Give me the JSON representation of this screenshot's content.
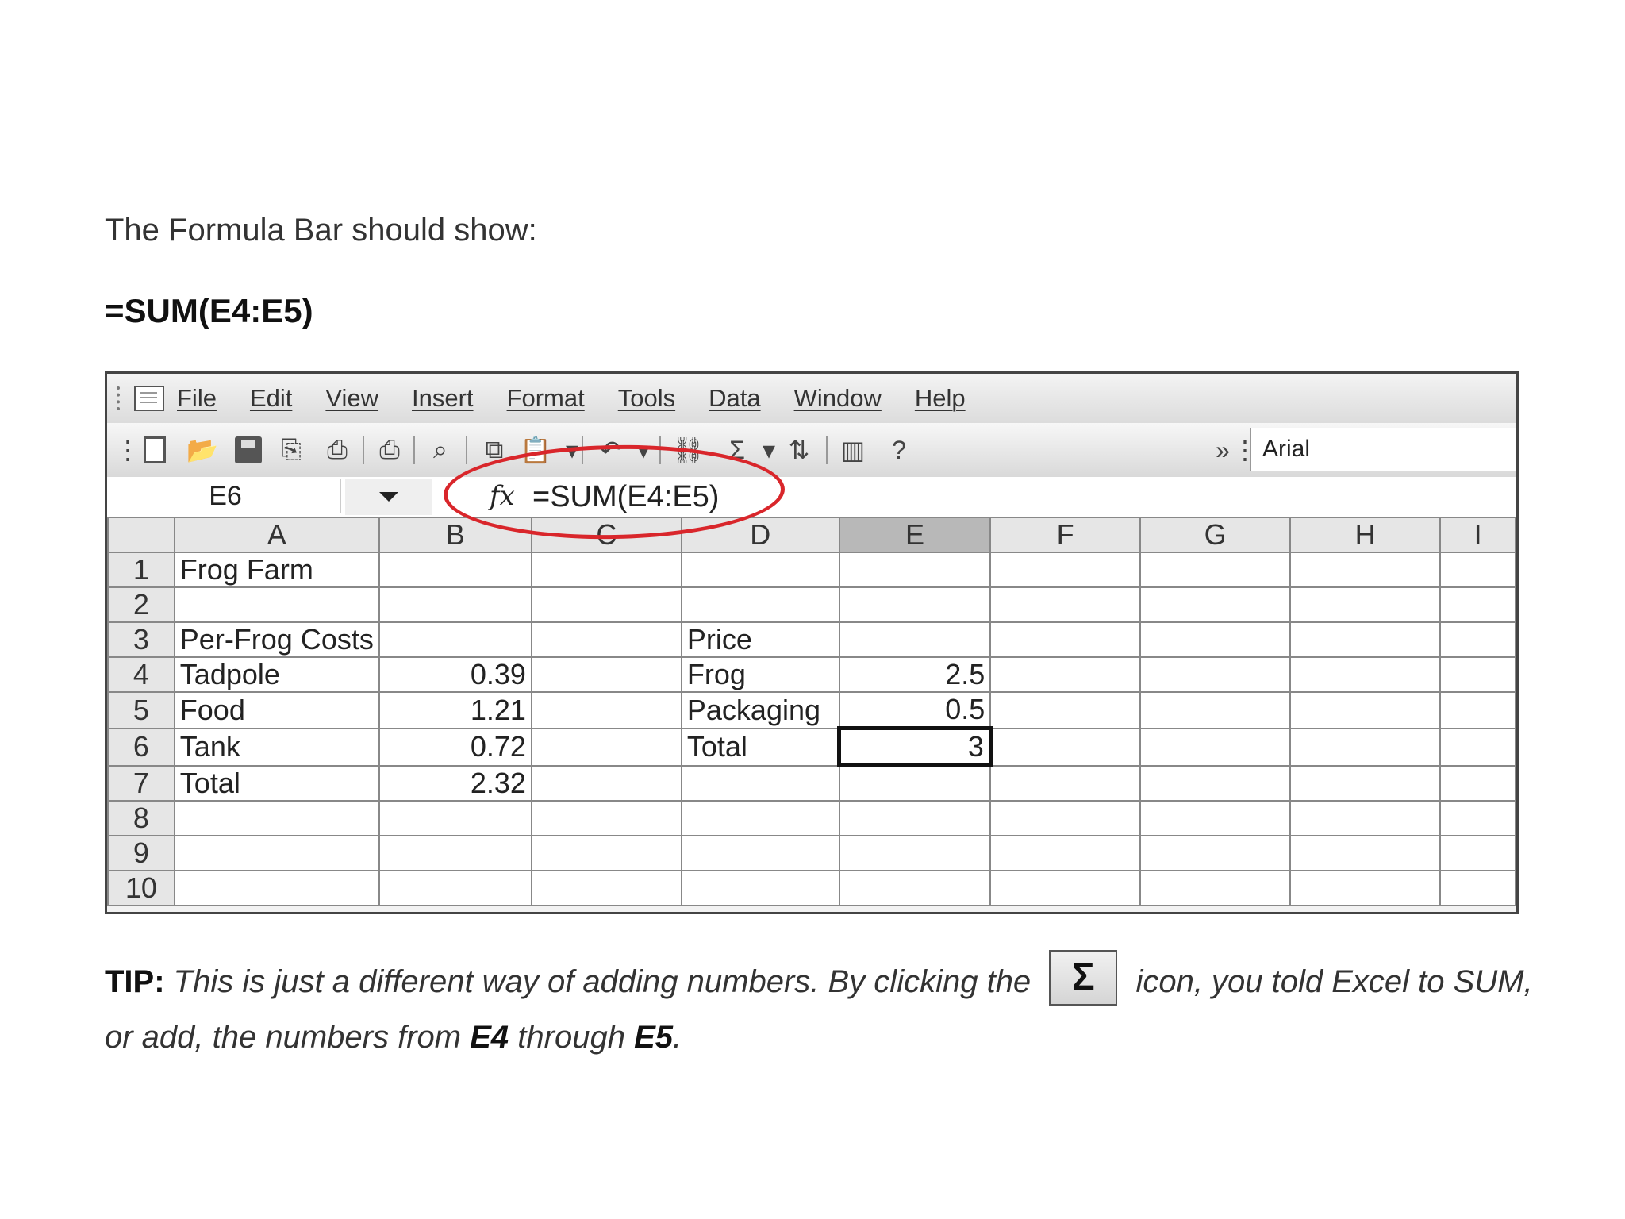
{
  "heading": "The Formula Bar should show:",
  "formula_note": "=SUM(E4:E5)",
  "excel": {
    "menu": [
      "File",
      "Edit",
      "View",
      "Insert",
      "Format",
      "Tools",
      "Data",
      "Window",
      "Help"
    ],
    "font_name": "Arial",
    "name_box": "E6",
    "fx_symbol": "fx",
    "formula": "=SUM(E4:E5)",
    "columns": [
      "A",
      "B",
      "C",
      "D",
      "E",
      "F",
      "G",
      "H",
      "I"
    ],
    "selected_column": "E",
    "rows": [
      {
        "num": "1",
        "cells": [
          "Frog Farm",
          "",
          "",
          "",
          "",
          "",
          "",
          "",
          ""
        ]
      },
      {
        "num": "2",
        "cells": [
          "",
          "",
          "",
          "",
          "",
          "",
          "",
          "",
          ""
        ]
      },
      {
        "num": "3",
        "cells": [
          "Per-Frog Costs",
          "",
          "",
          "Price",
          "",
          "",
          "",
          "",
          ""
        ]
      },
      {
        "num": "4",
        "cells": [
          "Tadpole",
          "0.39",
          "",
          "Frog",
          "2.5",
          "",
          "",
          "",
          ""
        ]
      },
      {
        "num": "5",
        "cells": [
          "Food",
          "1.21",
          "",
          "Packaging",
          "0.5",
          "",
          "",
          "",
          ""
        ]
      },
      {
        "num": "6",
        "cells": [
          "Tank",
          "0.72",
          "",
          "Total",
          "3",
          "",
          "",
          "",
          ""
        ]
      },
      {
        "num": "7",
        "cells": [
          "Total",
          "2.32",
          "",
          "",
          "",
          "",
          "",
          "",
          ""
        ]
      },
      {
        "num": "8",
        "cells": [
          "",
          "",
          "",
          "",
          "",
          "",
          "",
          "",
          ""
        ]
      },
      {
        "num": "9",
        "cells": [
          "",
          "",
          "",
          "",
          "",
          "",
          "",
          "",
          ""
        ]
      },
      {
        "num": "10",
        "cells": [
          "",
          "",
          "",
          "",
          "",
          "",
          "",
          "",
          ""
        ]
      }
    ],
    "active_cell": "E6",
    "highlight_color": "#d9262b"
  },
  "tip": {
    "label": "TIP:",
    "text1": "This is just a different way of adding numbers. By clicking the",
    "sigma": "Σ",
    "text2": "icon, you told Excel to SUM, or add, the numbers from",
    "ref1": "E4",
    "text3": "through",
    "ref2": "E5",
    "text4": "."
  }
}
